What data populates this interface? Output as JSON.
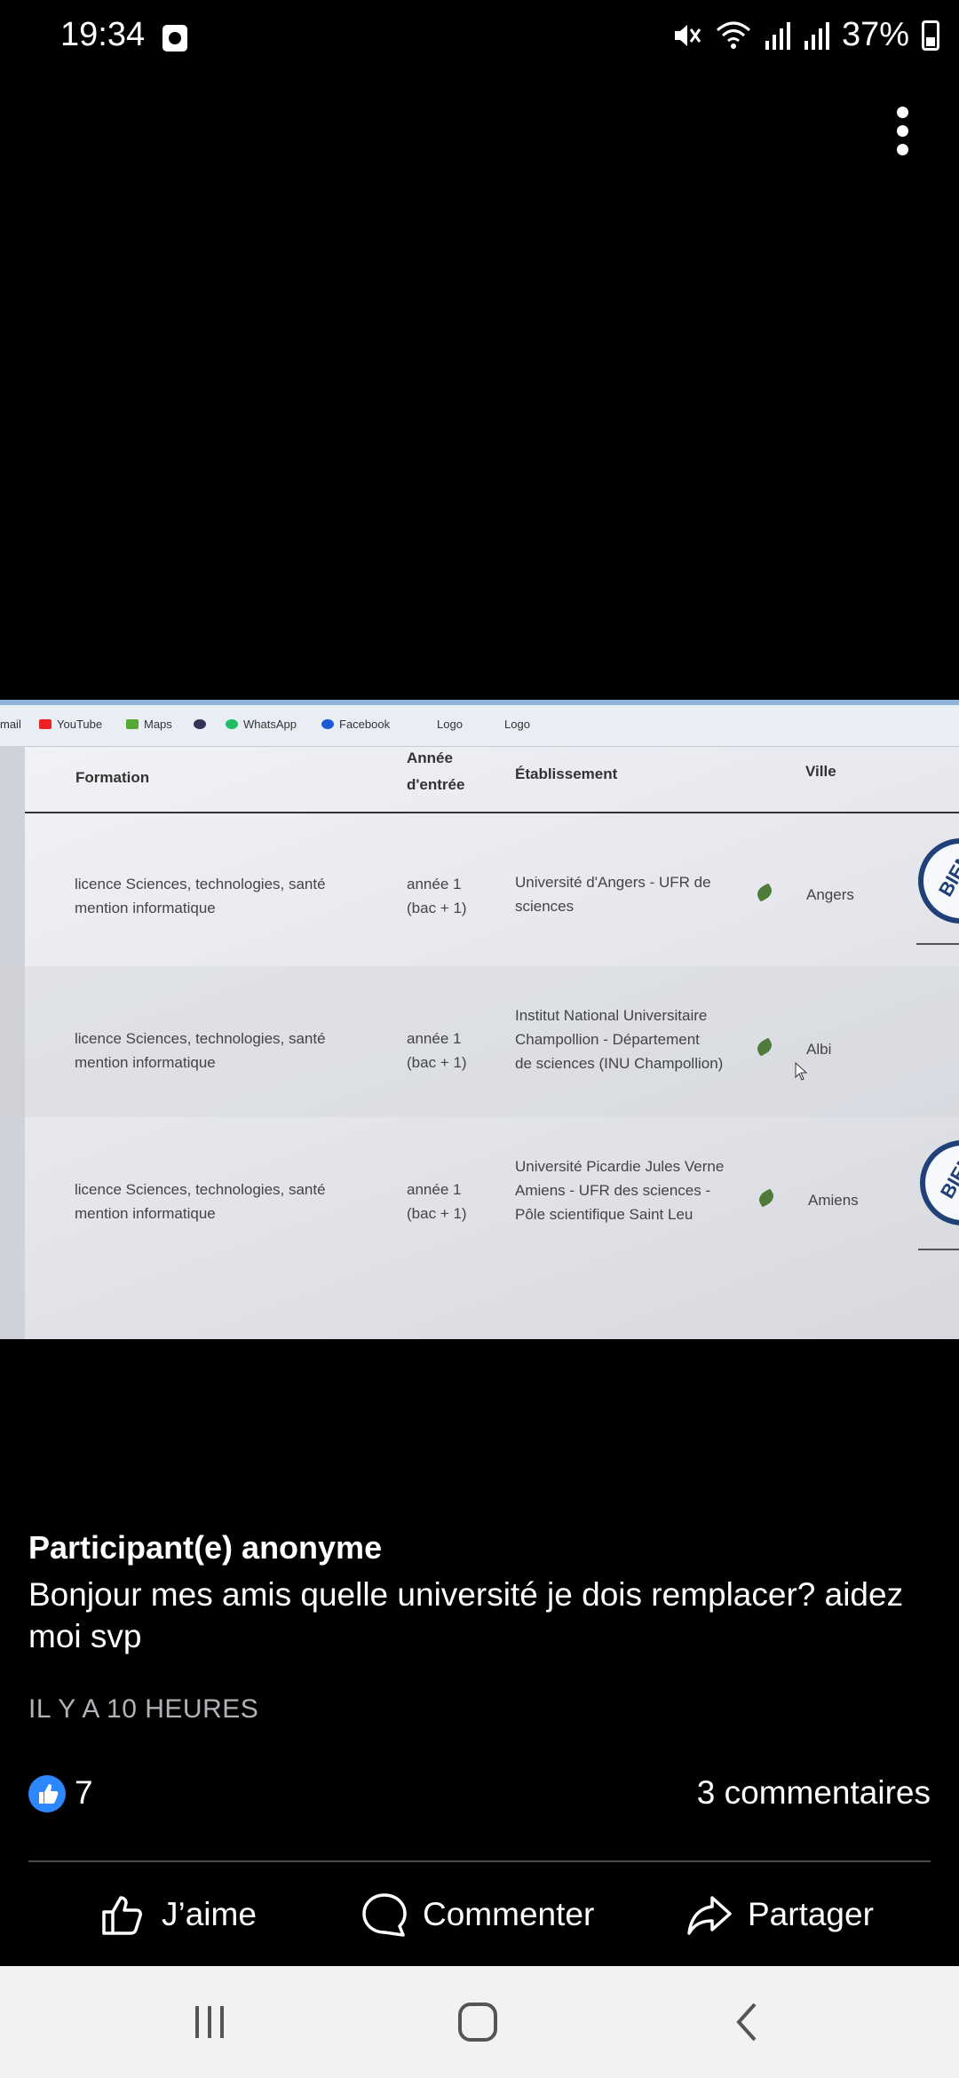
{
  "status_bar": {
    "time": "19:34",
    "battery": "37%",
    "icons": [
      "alarm-icon",
      "mute-icon",
      "wifi-icon",
      "signal-icon",
      "signal-icon",
      "battery-charging-icon"
    ]
  },
  "photo": {
    "bookmarks": [
      "mail",
      "YouTube",
      "Maps",
      "WhatsApp",
      "Facebook",
      "Logo",
      "Logo"
    ],
    "table": {
      "headers": {
        "formation": "Formation",
        "annee_1": "Année",
        "annee_2": "d'entrée",
        "etablissement": "Établissement",
        "ville": "Ville"
      },
      "rows": [
        {
          "formation_1": "licence Sciences, technologies, santé",
          "formation_2": "mention informatique",
          "annee_1": "année 1",
          "annee_2": "(bac + 1)",
          "etab_1": "Université d'Angers - UFR de",
          "etab_2": "sciences",
          "etab_3": "",
          "ville": "Angers"
        },
        {
          "formation_1": "licence Sciences, technologies, santé",
          "formation_2": "mention informatique",
          "annee_1": "année 1",
          "annee_2": "(bac + 1)",
          "etab_1": "Institut National Universitaire",
          "etab_2": "Champollion - Département",
          "etab_3": "de sciences (INU Champollion)",
          "ville": "Albi"
        },
        {
          "formation_1": "licence Sciences, technologies, santé",
          "formation_2": "mention informatique",
          "annee_1": "année 1",
          "annee_2": "(bac + 1)",
          "etab_1": "Université Picardie Jules Verne",
          "etab_2": "Amiens - UFR des sciences -",
          "etab_3": "Pôle scientifique Saint Leu",
          "ville": "Amiens"
        }
      ],
      "seal_text": "BIEN"
    }
  },
  "post": {
    "author": "Participant(e) anonyme",
    "message": "Bonjour mes amis quelle université je dois remplacer? aidez moi svp",
    "time": "IL Y A 10 HEURES",
    "likes": "7",
    "comments": "3 commentaires"
  },
  "actions": {
    "like": "J’aime",
    "comment": "Commenter",
    "share": "Partager"
  },
  "colors": {
    "background": "#000000",
    "like_blue": "#2d88ff",
    "nav_bar": "#f2f2f2"
  }
}
